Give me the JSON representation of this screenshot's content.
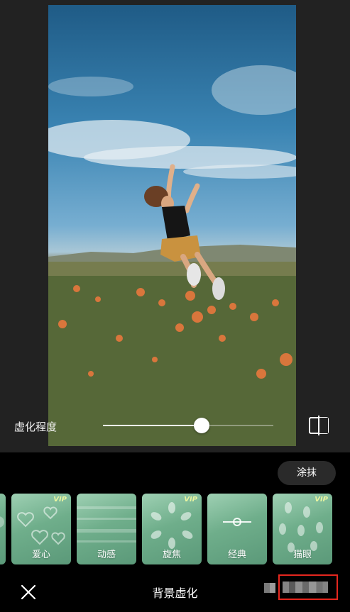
{
  "editor": {
    "blur_degree_label": "虚化程度",
    "blur_level_percent": 58
  },
  "panel": {
    "smear_button_label": "涂抹",
    "effects": [
      {
        "name": "",
        "vip": false
      },
      {
        "name": "爱心",
        "vip": true
      },
      {
        "name": "动感",
        "vip": false
      },
      {
        "name": "旋焦",
        "vip": true
      },
      {
        "name": "经典",
        "vip": false
      },
      {
        "name": "猫眼",
        "vip": true
      }
    ],
    "vip_badge": "VIP"
  },
  "bottom_bar": {
    "title": "背景虚化"
  },
  "colors": {
    "background": "#222222",
    "panel": "#000000",
    "effect_green": "#6fae8b",
    "highlight_red": "#e5271f"
  }
}
